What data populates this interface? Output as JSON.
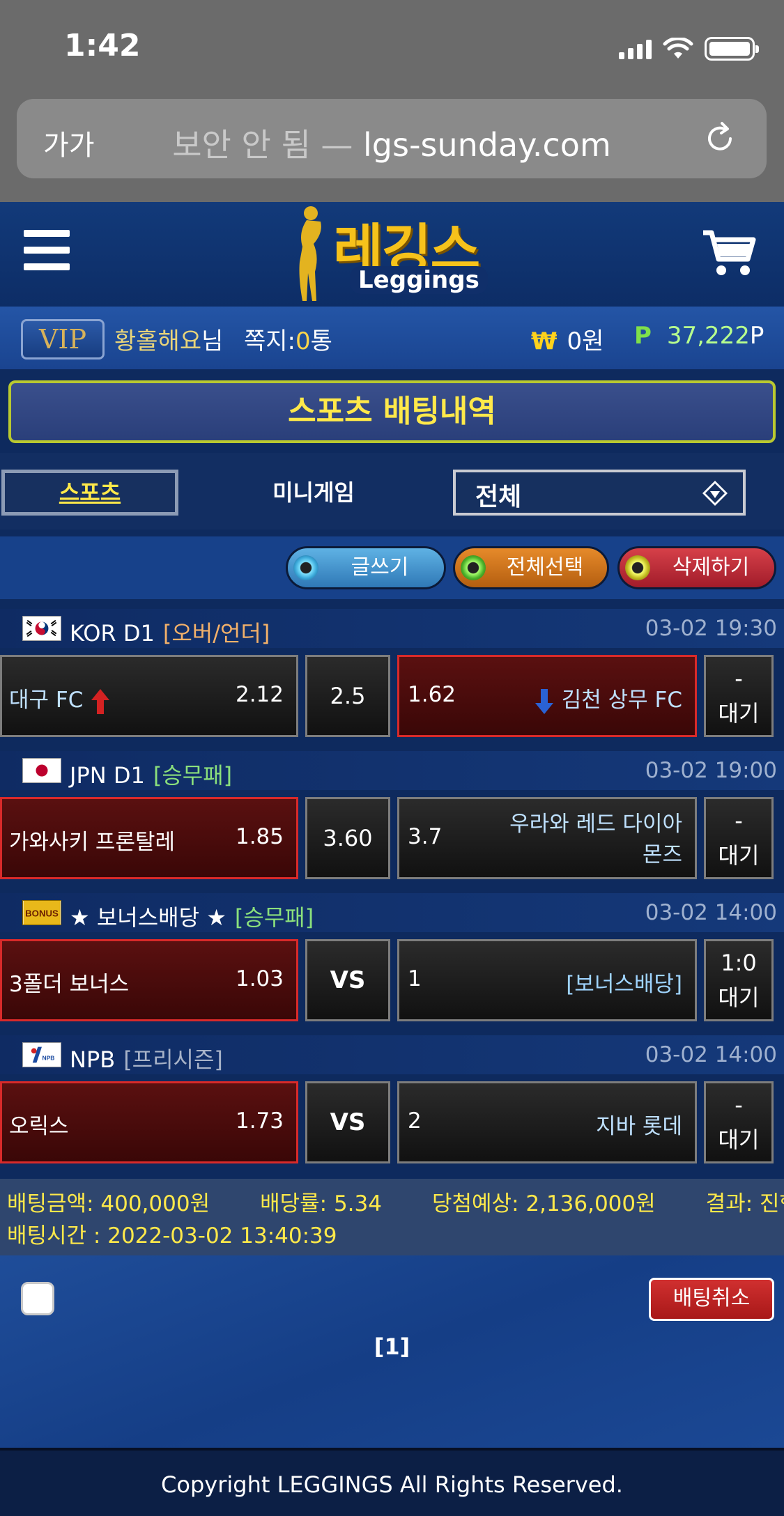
{
  "status_bar": {
    "time": "1:42"
  },
  "browser": {
    "aa_label": "가가",
    "insecure_label": "보안 안 됨 —",
    "domain": "lgs-sunday.com"
  },
  "header": {
    "logo_korean": "레깅스",
    "logo_english": "Leggings"
  },
  "userbar": {
    "vip": "VIP",
    "username": "황홀해요",
    "username_suffix": "님",
    "messages_label": "쪽지:",
    "messages_count": "0",
    "messages_unit": "통",
    "won_symbol": "₩",
    "won_value": "0원",
    "point_symbol": "P",
    "point_value": "37,222",
    "point_unit": "P"
  },
  "page_title": "스포츠 배팅내역",
  "tabs": {
    "sports": "스포츠",
    "minigame": "미니게임",
    "filter_value": "전체"
  },
  "actions": {
    "write": "글쓰기",
    "select_all": "전체선택",
    "delete": "삭제하기"
  },
  "matches": [
    {
      "league": "KOR D1",
      "kind": "[오버/언더]",
      "time": "03-02 19:30",
      "home": "대구 FC",
      "home_odds": "2.12",
      "mid": "2.5",
      "away_odds": "1.62",
      "away": "김천 상무 FC",
      "state_top": "-",
      "state_bottom": "대기"
    },
    {
      "league": "JPN D1",
      "kind": "[승무패]",
      "time": "03-02 19:00",
      "home": "가와사키 프론탈레",
      "home_odds": "1.85",
      "mid": "3.60",
      "away_odds": "3.7",
      "away_line1": "우라와 레드 다이아",
      "away_line2": "몬즈",
      "state_top": "-",
      "state_bottom": "대기"
    },
    {
      "league": "★ 보너스배당 ★",
      "kind": "[승무패]",
      "time": "03-02 14:00",
      "flag_text": "BONUS",
      "home": "3폴더 보너스",
      "home_odds": "1.03",
      "mid": "VS",
      "away_odds": "1",
      "away": "[보너스배당]",
      "state_top": "1:0",
      "state_bottom": "대기"
    },
    {
      "league": "NPB",
      "kind": "[프리시즌]",
      "time": "03-02 14:00",
      "home": "오릭스",
      "home_odds": "1.73",
      "mid": "VS",
      "away_odds": "2",
      "away": "지바 롯데",
      "state_top": "-",
      "state_bottom": "대기"
    }
  ],
  "summary": {
    "bet_amount": "배팅금액: 400,000원",
    "odds": "배당률: 5.34",
    "expected": "당첨예상: 2,136,000원",
    "result": "결과: 진행중",
    "bet_time": "배팅시간 : 2022-03-02 13:40:39"
  },
  "cancel_button": "배팅취소",
  "pager": "[1]",
  "footer": "Copyright LEGGINGS All Rights Reserved.",
  "colors": {
    "background": "#0e2a5e",
    "accent_yellow": "#ffe94a",
    "selected_red": "#d82a2a",
    "cancel_red": "#c02424"
  }
}
